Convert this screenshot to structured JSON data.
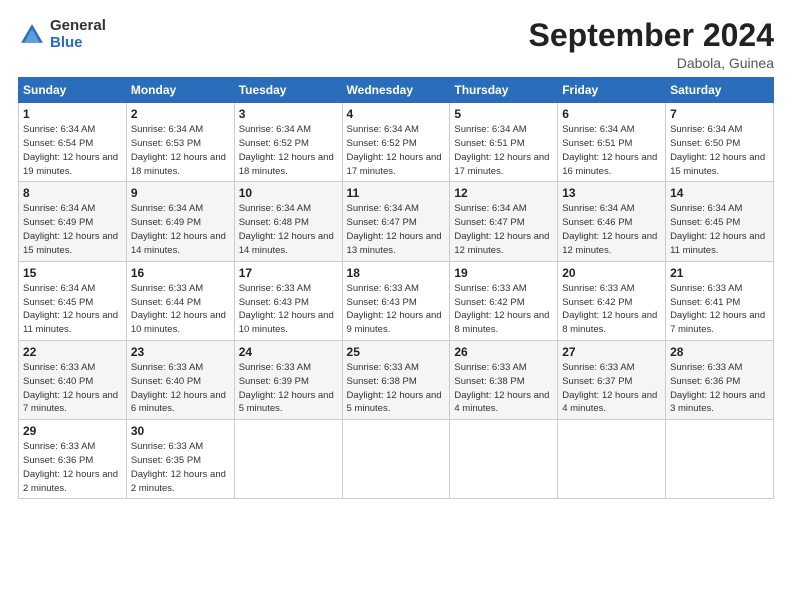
{
  "header": {
    "logo_general": "General",
    "logo_blue": "Blue",
    "month_title": "September 2024",
    "location": "Dabola, Guinea"
  },
  "days_of_week": [
    "Sunday",
    "Monday",
    "Tuesday",
    "Wednesday",
    "Thursday",
    "Friday",
    "Saturday"
  ],
  "weeks": [
    [
      {
        "day": "1",
        "sunrise": "6:34 AM",
        "sunset": "6:54 PM",
        "daylight": "12 hours and 19 minutes."
      },
      {
        "day": "2",
        "sunrise": "6:34 AM",
        "sunset": "6:53 PM",
        "daylight": "12 hours and 18 minutes."
      },
      {
        "day": "3",
        "sunrise": "6:34 AM",
        "sunset": "6:52 PM",
        "daylight": "12 hours and 18 minutes."
      },
      {
        "day": "4",
        "sunrise": "6:34 AM",
        "sunset": "6:52 PM",
        "daylight": "12 hours and 17 minutes."
      },
      {
        "day": "5",
        "sunrise": "6:34 AM",
        "sunset": "6:51 PM",
        "daylight": "12 hours and 17 minutes."
      },
      {
        "day": "6",
        "sunrise": "6:34 AM",
        "sunset": "6:51 PM",
        "daylight": "12 hours and 16 minutes."
      },
      {
        "day": "7",
        "sunrise": "6:34 AM",
        "sunset": "6:50 PM",
        "daylight": "12 hours and 15 minutes."
      }
    ],
    [
      {
        "day": "8",
        "sunrise": "6:34 AM",
        "sunset": "6:49 PM",
        "daylight": "12 hours and 15 minutes."
      },
      {
        "day": "9",
        "sunrise": "6:34 AM",
        "sunset": "6:49 PM",
        "daylight": "12 hours and 14 minutes."
      },
      {
        "day": "10",
        "sunrise": "6:34 AM",
        "sunset": "6:48 PM",
        "daylight": "12 hours and 14 minutes."
      },
      {
        "day": "11",
        "sunrise": "6:34 AM",
        "sunset": "6:47 PM",
        "daylight": "12 hours and 13 minutes."
      },
      {
        "day": "12",
        "sunrise": "6:34 AM",
        "sunset": "6:47 PM",
        "daylight": "12 hours and 12 minutes."
      },
      {
        "day": "13",
        "sunrise": "6:34 AM",
        "sunset": "6:46 PM",
        "daylight": "12 hours and 12 minutes."
      },
      {
        "day": "14",
        "sunrise": "6:34 AM",
        "sunset": "6:45 PM",
        "daylight": "12 hours and 11 minutes."
      }
    ],
    [
      {
        "day": "15",
        "sunrise": "6:34 AM",
        "sunset": "6:45 PM",
        "daylight": "12 hours and 11 minutes."
      },
      {
        "day": "16",
        "sunrise": "6:33 AM",
        "sunset": "6:44 PM",
        "daylight": "12 hours and 10 minutes."
      },
      {
        "day": "17",
        "sunrise": "6:33 AM",
        "sunset": "6:43 PM",
        "daylight": "12 hours and 10 minutes."
      },
      {
        "day": "18",
        "sunrise": "6:33 AM",
        "sunset": "6:43 PM",
        "daylight": "12 hours and 9 minutes."
      },
      {
        "day": "19",
        "sunrise": "6:33 AM",
        "sunset": "6:42 PM",
        "daylight": "12 hours and 8 minutes."
      },
      {
        "day": "20",
        "sunrise": "6:33 AM",
        "sunset": "6:42 PM",
        "daylight": "12 hours and 8 minutes."
      },
      {
        "day": "21",
        "sunrise": "6:33 AM",
        "sunset": "6:41 PM",
        "daylight": "12 hours and 7 minutes."
      }
    ],
    [
      {
        "day": "22",
        "sunrise": "6:33 AM",
        "sunset": "6:40 PM",
        "daylight": "12 hours and 7 minutes."
      },
      {
        "day": "23",
        "sunrise": "6:33 AM",
        "sunset": "6:40 PM",
        "daylight": "12 hours and 6 minutes."
      },
      {
        "day": "24",
        "sunrise": "6:33 AM",
        "sunset": "6:39 PM",
        "daylight": "12 hours and 5 minutes."
      },
      {
        "day": "25",
        "sunrise": "6:33 AM",
        "sunset": "6:38 PM",
        "daylight": "12 hours and 5 minutes."
      },
      {
        "day": "26",
        "sunrise": "6:33 AM",
        "sunset": "6:38 PM",
        "daylight": "12 hours and 4 minutes."
      },
      {
        "day": "27",
        "sunrise": "6:33 AM",
        "sunset": "6:37 PM",
        "daylight": "12 hours and 4 minutes."
      },
      {
        "day": "28",
        "sunrise": "6:33 AM",
        "sunset": "6:36 PM",
        "daylight": "12 hours and 3 minutes."
      }
    ],
    [
      {
        "day": "29",
        "sunrise": "6:33 AM",
        "sunset": "6:36 PM",
        "daylight": "12 hours and 2 minutes."
      },
      {
        "day": "30",
        "sunrise": "6:33 AM",
        "sunset": "6:35 PM",
        "daylight": "12 hours and 2 minutes."
      },
      null,
      null,
      null,
      null,
      null
    ]
  ]
}
